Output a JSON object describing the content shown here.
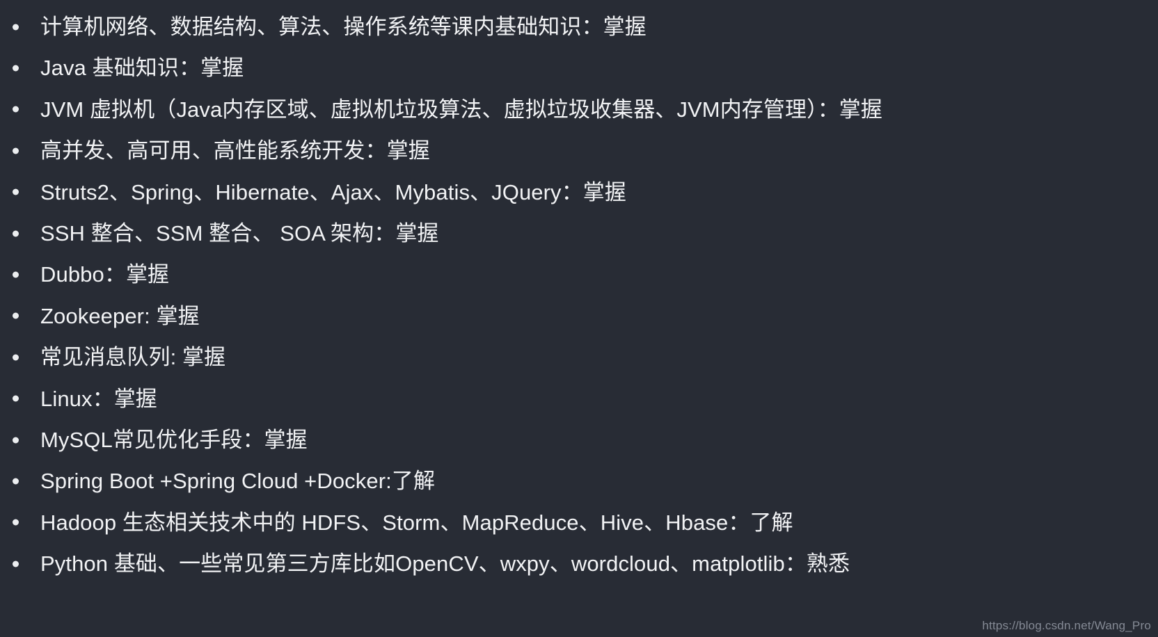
{
  "background_color": "#282c35",
  "text_color": "#f2f3f5",
  "bullet_color": "#eceef0",
  "watermark_color": "#8d939e",
  "skills": {
    "items": [
      {
        "text": "计算机网络、数据结构、算法、操作系统等课内基础知识：掌握"
      },
      {
        "text": "Java 基础知识：掌握"
      },
      {
        "text": "JVM 虚拟机（Java内存区域、虚拟机垃圾算法、虚拟垃圾收集器、JVM内存管理）：掌握"
      },
      {
        "text": "高并发、高可用、高性能系统开发：掌握"
      },
      {
        "text": "Struts2、Spring、Hibernate、Ajax、Mybatis、JQuery：掌握"
      },
      {
        "text": "SSH 整合、SSM 整合、 SOA 架构：掌握"
      },
      {
        "text": "Dubbo：掌握"
      },
      {
        "text": "Zookeeper: 掌握"
      },
      {
        "text": "常见消息队列: 掌握"
      },
      {
        "text": "Linux：掌握"
      },
      {
        "text": "MySQL常见优化手段：掌握"
      },
      {
        "text": "Spring Boot +Spring Cloud +Docker:了解"
      },
      {
        "text": "Hadoop 生态相关技术中的 HDFS、Storm、MapReduce、Hive、Hbase：了解"
      },
      {
        "text": "Python 基础、一些常见第三方库比如OpenCV、wxpy、wordcloud、matplotlib：熟悉"
      }
    ]
  },
  "watermark": {
    "url": "https://blog.csdn.net/Wang_Pro"
  }
}
